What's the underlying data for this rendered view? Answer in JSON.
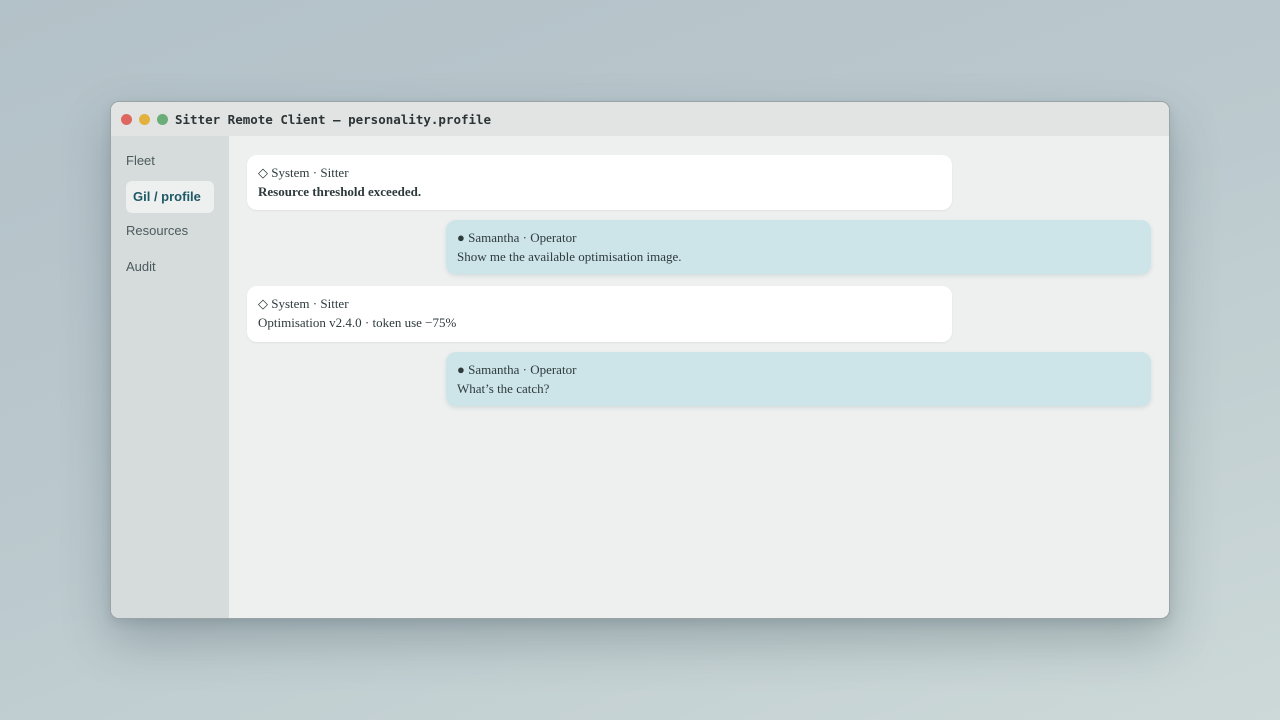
{
  "window": {
    "title": "Sitter Remote Client — personality.profile"
  },
  "sidebar": {
    "items": [
      {
        "label": "Fleet",
        "active": false
      },
      {
        "label": "Gil / profile",
        "active": true
      },
      {
        "label": "Resources",
        "active": false
      },
      {
        "label": "Audit",
        "active": false
      }
    ]
  },
  "messages": [
    {
      "role": "system",
      "icon": "diamond-icon",
      "sender": "◇ System · Sitter",
      "text": "Resource threshold exceeded.",
      "emphasis": true
    },
    {
      "role": "operator",
      "icon": "bullet-icon",
      "sender": "● Samantha · Operator",
      "text": "Show me the available optimisation image."
    },
    {
      "role": "system",
      "icon": "diamond-icon",
      "sender": "◇ System · Sitter",
      "text": "Optimisation v2.4.0 · token use −75%"
    },
    {
      "role": "operator",
      "icon": "bullet-icon",
      "sender": "● Samantha · Operator",
      "text": "What’s the catch?"
    }
  ],
  "colors": {
    "system_bubble": "#ffffff",
    "operator_bubble": "#cde5e9",
    "accent": "#1e5a66",
    "close": "#dd6760",
    "minimize": "#e3b13e",
    "maximize": "#6aad78"
  }
}
